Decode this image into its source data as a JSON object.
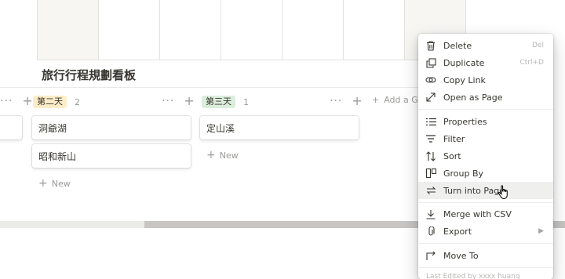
{
  "board": {
    "title": "旅行行程規劃看板",
    "columns": [
      {
        "tag": "第二天",
        "count": "2",
        "cards": [
          "洞爺湖",
          "昭和新山"
        ],
        "new_label": "New"
      },
      {
        "tag": "第三天",
        "count": "1",
        "cards": [
          "定山溪"
        ],
        "new_label": "New"
      }
    ],
    "add_group_label": "Add a Gr",
    "more_glyph": "···",
    "plus_glyph": "+"
  },
  "menu": {
    "items": [
      {
        "icon": "trash-icon",
        "label": "Delete",
        "shortcut": "Del"
      },
      {
        "icon": "duplicate-icon",
        "label": "Duplicate",
        "shortcut": "Ctrl+D"
      },
      {
        "icon": "link-icon",
        "label": "Copy Link"
      },
      {
        "icon": "expand-icon",
        "label": "Open as Page"
      },
      {
        "icon": "list-icon",
        "label": "Properties"
      },
      {
        "icon": "filter-icon",
        "label": "Filter"
      },
      {
        "icon": "sort-icon",
        "label": "Sort"
      },
      {
        "icon": "group-icon",
        "label": "Group By"
      },
      {
        "icon": "turn-into-icon",
        "label": "Turn into Page"
      },
      {
        "icon": "download-icon",
        "label": "Merge with CSV"
      },
      {
        "icon": "paperclip-icon",
        "label": "Export"
      },
      {
        "icon": "move-to-icon",
        "label": "Move To"
      }
    ],
    "footer": "Last Edited by xxxx huang"
  },
  "colors": {
    "tag_yellow": "#fdecc8",
    "tag_green": "#dbeddb",
    "hover": "#efefee"
  }
}
